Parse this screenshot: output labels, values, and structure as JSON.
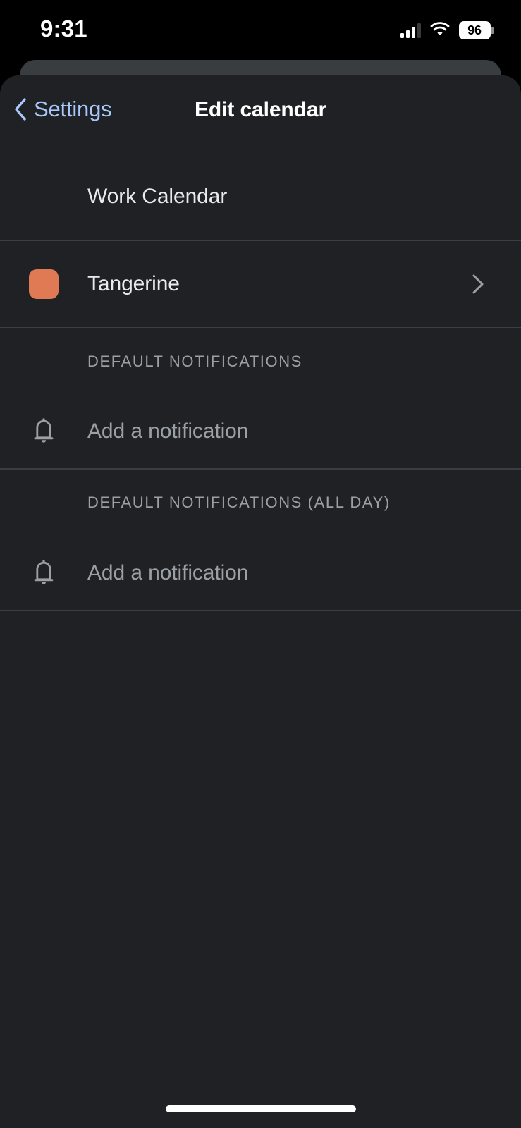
{
  "status_bar": {
    "time": "9:31",
    "battery_percent": "96",
    "icons": [
      "cellular-signal-icon",
      "wifi-icon",
      "battery-icon"
    ]
  },
  "nav": {
    "back_label": "Settings",
    "title": "Edit calendar",
    "back_icon": "chevron-left-icon",
    "accent_color": "#A8C7FA"
  },
  "calendar": {
    "name_row": {
      "title": "Work Calendar"
    },
    "color_row": {
      "title": "Tangerine",
      "swatch_color": "#DF7A54",
      "trailing_icon": "chevron-right-icon"
    }
  },
  "sections": [
    {
      "header": "DEFAULT NOTIFICATIONS",
      "rows": [
        {
          "icon": "bell-icon",
          "label": "Add a notification"
        }
      ]
    },
    {
      "header": "DEFAULT NOTIFICATIONS (ALL DAY)",
      "rows": [
        {
          "icon": "bell-icon",
          "label": "Add a notification"
        }
      ]
    }
  ],
  "theme": {
    "background": "#202124",
    "divider": "#3A3E42",
    "primary_text": "#E8EAED",
    "secondary_text": "#9AA0A6"
  }
}
